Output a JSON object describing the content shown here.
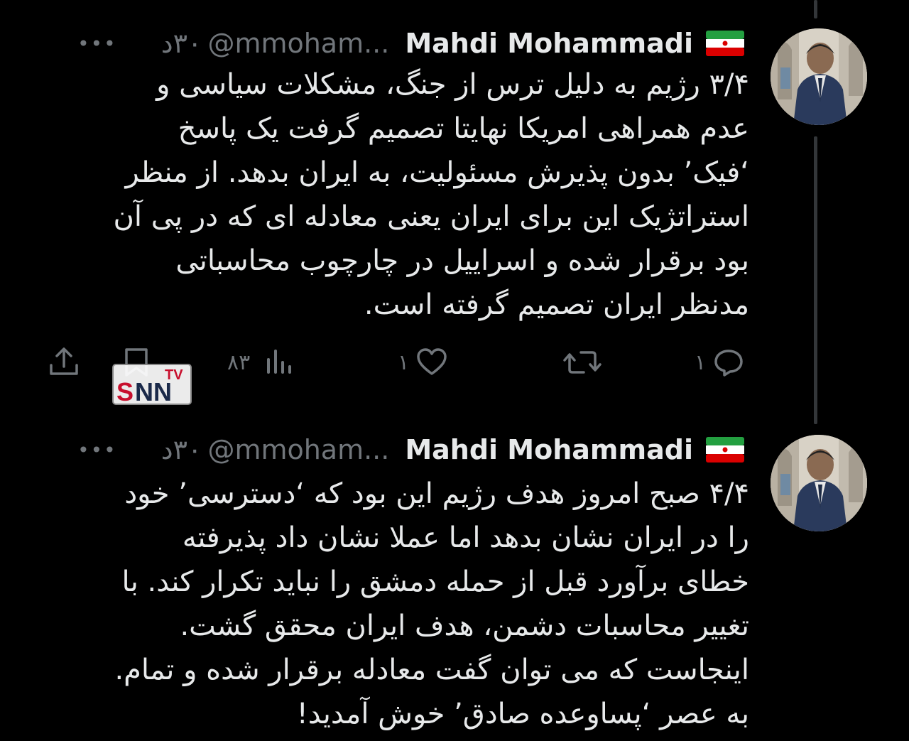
{
  "colors": {
    "background": "#000000",
    "text": "#e7e9ea",
    "muted": "#71767b",
    "thread_line": "#333639"
  },
  "tweets": [
    {
      "author_name": "Mahdi Mohammadi",
      "handle": "@mmoham...",
      "time": "۳۰د",
      "more": "•••",
      "lines": [
        "۳/۴ رژیم به دلیل ترس از جنگ، مشکلات سیاسی و",
        "عدم همراهی امریکا نهایتا تصمیم گرفت یک پاسخ",
        "‘فیک’ بدون پذیرش مسئولیت، به ایران بدهد. از منظر",
        "استراتژیک این برای ایران یعنی معادله ای که  در پی آن",
        "بود برقرار شده و اسراییل در چارچوب محاسباتی",
        "مدنظر ایران تصمیم گرفته است."
      ],
      "stats": {
        "replies": "۱",
        "likes": "۱",
        "views": "۸۳"
      },
      "icons": [
        "reply-icon",
        "retweet-icon",
        "like-icon",
        "views-icon",
        "bookmark-icon",
        "share-icon"
      ]
    },
    {
      "author_name": "Mahdi Mohammadi",
      "handle": "@mmoham...",
      "time": "۳۰د",
      "more": "•••",
      "lines": [
        "۴/۴ صبح امروز هدف رژیم این بود که ‘دسترسی’ خود",
        "را در ایران نشان بدهد اما عملا نشان داد پذیرفته",
        "خطای برآورد قبل از حمله دمشق را نباید تکرار کند. با",
        "تغییر محاسبات دشمن، هدف ایران محقق گشت.",
        "اینجاست که می توان گفت معادله برقرار شده و تمام.",
        "به عصر ‘پساوعده صادق’ خوش آمدید!"
      ]
    }
  ],
  "watermark": {
    "logo": "SNN",
    "badge": "TV"
  }
}
